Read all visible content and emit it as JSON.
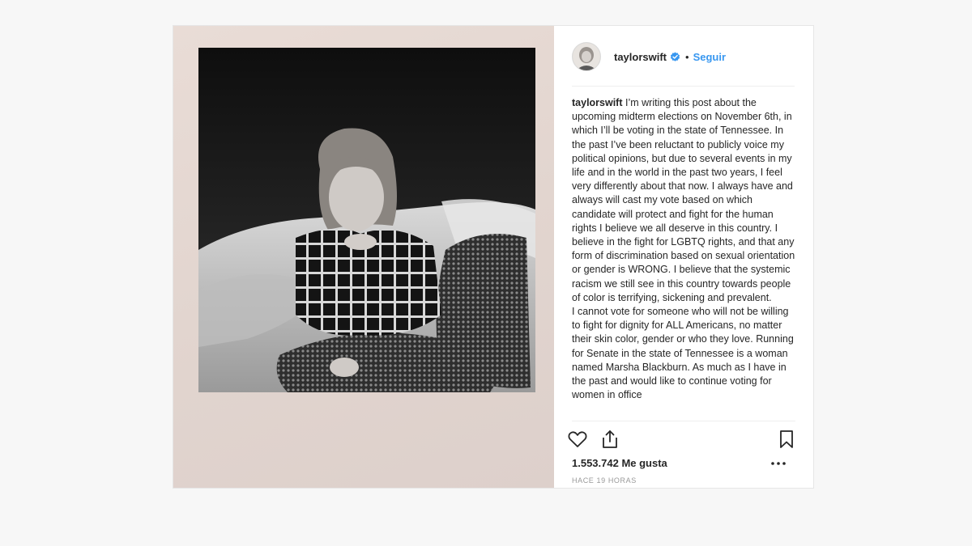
{
  "post": {
    "username": "taylorswift",
    "follow_label": "Seguir",
    "separator": "•",
    "verified": true,
    "photo_alt": "Polaroid photo",
    "caption_user": "taylorswift",
    "caption_text": " I’m writing this post about the upcoming midterm elections on November 6th, in which I’ll be voting in the state of Tennessee. In the past I’ve been reluctant to publicly voice my political opinions, but due to several events in my life and in the world in the past two years, I feel very differently about that now. I always have and always will cast my vote based on which candidate will protect and fight for the human rights I believe we all deserve in this country. I believe in the fight for LGBTQ rights, and that any form of discrimination based on sexual orientation or gender is WRONG. I believe that the systemic racism we still see in this country towards people of color is terrifying, sickening and prevalent.\nI cannot vote for someone who will not be willing to fight for dignity for ALL Americans, no matter their skin color, gender or who they love. Running for Senate in the state of Tennessee is a woman named Marsha Blackburn. As much as I have in the past and would like to continue voting for women in office",
    "likes_label": "1.553.742 Me gusta",
    "timestamp": "HACE 19 HORAS"
  },
  "icons": {
    "like": "heart-outline-icon",
    "share": "share-icon",
    "save": "bookmark-icon",
    "more": "more-options-icon",
    "verified": "verified-badge-icon"
  },
  "colors": {
    "accent_blue": "#3897f0",
    "text": "#262626",
    "muted": "#999999"
  }
}
